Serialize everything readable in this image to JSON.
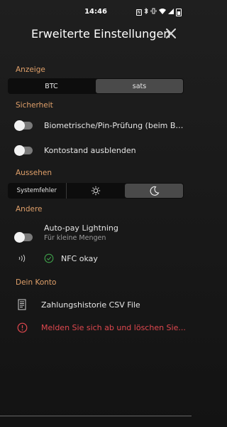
{
  "status_bar": {
    "time": "14:46"
  },
  "header": {
    "title": "Erweiterte Einstellungen"
  },
  "anzeige": {
    "label": "Anzeige",
    "options": [
      "BTC",
      "sats"
    ],
    "selected": "sats"
  },
  "sicherheit": {
    "label": "Sicherheit",
    "biometric_label": "Biometrische/Pin-Prüfung (beim Be...",
    "biometric_on": false,
    "hide_balance_label": "Kontostand ausblenden",
    "hide_balance_on": false
  },
  "aussehen": {
    "label": "Aussehen",
    "options": [
      "Systemfehler",
      "light",
      "dark"
    ],
    "selected": "dark"
  },
  "andere": {
    "label": "Andere",
    "autopay_label": "Auto-pay Lightning",
    "autopay_sub": "Für kleine Mengen",
    "autopay_on": false,
    "nfc_status": "NFC okay"
  },
  "konto": {
    "label": "Dein Konto",
    "csv_label": "Zahlungshistorie CSV File",
    "logout_label": "Melden Sie sich ab und löschen Sie...",
    "danger_color": "#e0484f"
  },
  "icons": [
    "nfc-icon",
    "bluetooth-icon",
    "vibrate-icon",
    "wifi-icon",
    "signal-icon",
    "battery-icon",
    "close-icon",
    "sun-icon",
    "moon-icon",
    "check-circle-icon",
    "document-icon",
    "alert-circle-icon"
  ]
}
